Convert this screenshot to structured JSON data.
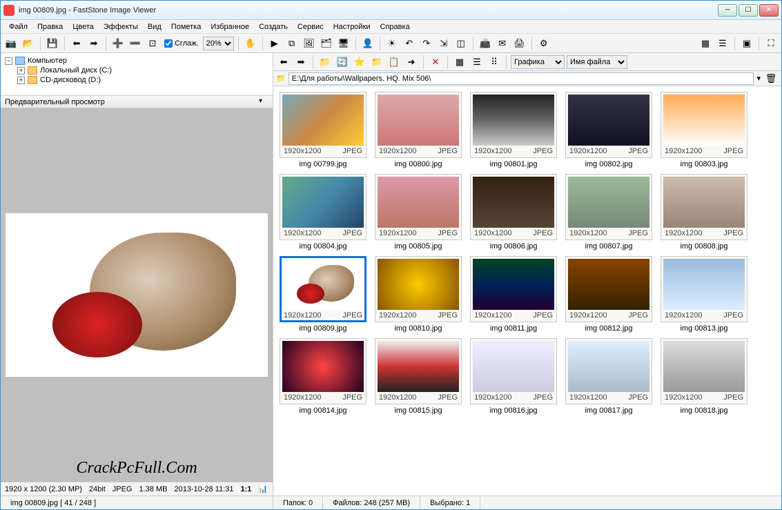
{
  "title": "img 00809.jpg  -  FastStone Image Viewer",
  "menu": [
    "Файл",
    "Правка",
    "Цвета",
    "Эффекты",
    "Вид",
    "Пометка",
    "Избранное",
    "Создать",
    "Сервис",
    "Настройки",
    "Справка"
  ],
  "toolbar": {
    "smooth_label": "Сглаж.",
    "zoom_value": "20%"
  },
  "tree": {
    "root": "Компьютер",
    "items": [
      "Локальный диск (C:)",
      "CD-дисковод (D:)"
    ]
  },
  "preview_header": "Предварительный просмотр",
  "watermark": "CrackPcFull.Com",
  "left_status": {
    "dims": "1920 x 1200 (2.30 MP)",
    "depth": "24bit",
    "fmt": "JPEG",
    "size": "1.38 MB",
    "date": "2013-10-28 11:31",
    "ratio": "1:1"
  },
  "right_toolbar": {
    "dropdown1": "Графика",
    "dropdown2": "Имя файла"
  },
  "path": "E:\\Для работы\\Wallpapers. HQ. Mix 506\\",
  "thumb_meta": {
    "res": "1920x1200",
    "fmt": "JPEG"
  },
  "thumbs": [
    {
      "name": "img 00799.jpg",
      "g": "g1"
    },
    {
      "name": "img 00800.jpg",
      "g": "g2"
    },
    {
      "name": "img 00801.jpg",
      "g": "g3"
    },
    {
      "name": "img 00802.jpg",
      "g": "g4"
    },
    {
      "name": "img 00803.jpg",
      "g": "g5"
    },
    {
      "name": "img 00804.jpg",
      "g": "g6"
    },
    {
      "name": "img 00805.jpg",
      "g": "g7"
    },
    {
      "name": "img 00806.jpg",
      "g": "g8"
    },
    {
      "name": "img 00807.jpg",
      "g": "g9"
    },
    {
      "name": "img 00808.jpg",
      "g": "g10"
    },
    {
      "name": "img 00809.jpg",
      "g": "g11",
      "sel": true,
      "dog": true
    },
    {
      "name": "img 00810.jpg",
      "g": "g12"
    },
    {
      "name": "img 00811.jpg",
      "g": "g13"
    },
    {
      "name": "img 00812.jpg",
      "g": "g14"
    },
    {
      "name": "img 00813.jpg",
      "g": "g15"
    },
    {
      "name": "img 00814.jpg",
      "g": "g16"
    },
    {
      "name": "img 00815.jpg",
      "g": "g17"
    },
    {
      "name": "img 00816.jpg",
      "g": "g18"
    },
    {
      "name": "img 00817.jpg",
      "g": "g19"
    },
    {
      "name": "img 00818.jpg",
      "g": "g20"
    }
  ],
  "bottom_status": {
    "file": "img 00809.jpg  [ 41 / 248 ]",
    "folders": "Папок: 0",
    "files": "Файлов: 248 (257 MB)",
    "selected": "Выбрано: 1"
  }
}
